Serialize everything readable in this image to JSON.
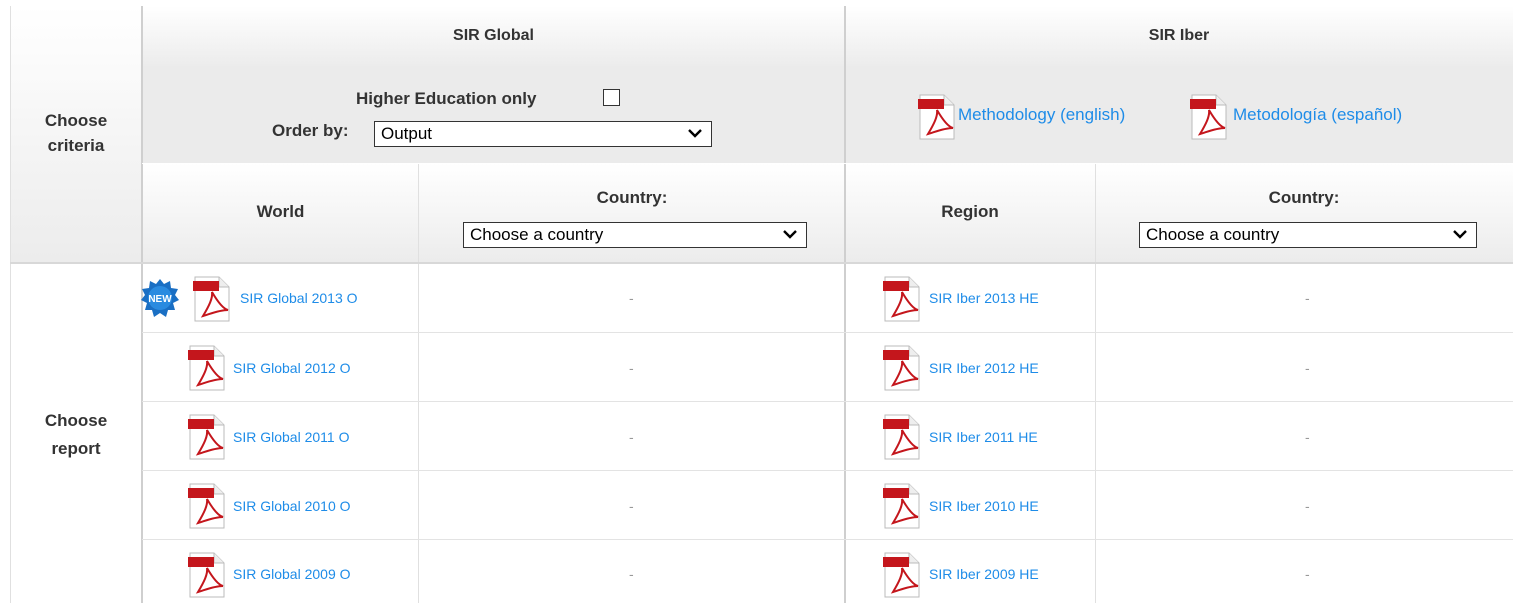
{
  "left_labels": {
    "criteria_1": "Choose",
    "criteria_2": "criteria",
    "report_1": "Choose",
    "report_2": "report"
  },
  "global": {
    "title": "SIR Global",
    "he_label": "Higher Education only",
    "order_label": "Order by:",
    "order_value": "Output",
    "world_label": "World",
    "country_label": "Country:",
    "country_value": "Choose a country",
    "new_badge": "NEW",
    "reports": [
      "SIR Global 2013 O",
      "SIR Global 2012 O",
      "SIR Global 2011 O",
      "SIR Global 2010 O",
      "SIR Global 2009 O"
    ]
  },
  "iber": {
    "title": "SIR Iber",
    "methodology_en": "Methodology (english)",
    "methodology_es": "Metodología (español)",
    "region_label": "Region",
    "country_label": "Country:",
    "country_value": "Choose a country",
    "reports": [
      "SIR Iber 2013 HE",
      "SIR Iber 2012 HE",
      "SIR Iber 2011 HE",
      "SIR Iber 2010 HE",
      "SIR Iber 2009 HE"
    ]
  },
  "dash": "-",
  "icons": {
    "pdf": "pdf-file-icon",
    "new": "new-badge-icon",
    "chevron": "chevron-down-icon"
  }
}
